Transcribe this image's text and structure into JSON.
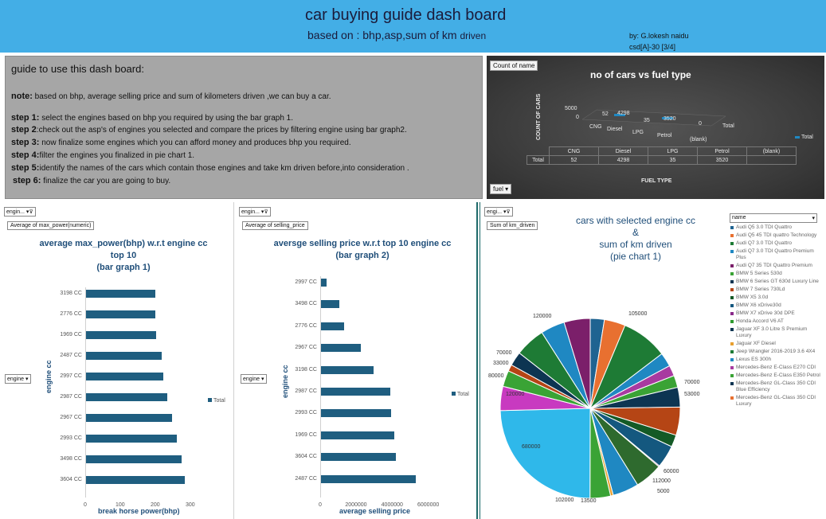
{
  "header": {
    "title": "car buying guide dash board",
    "subtitle_main": "based on : bhp,asp,sum of km",
    "subtitle_small": "driven",
    "author": "by: G.lokesh naidu",
    "class": "csd[A]-30 [3/4]"
  },
  "guide": {
    "heading": "guide to use this dash board:",
    "note_label": "note:",
    "note": " based on bhp, average selling price and sum of kilometers driven ,we can buy a car.",
    "steps": [
      {
        "label": "step 1:",
        "text": " select the engines based on bhp you required by using the bar graph 1."
      },
      {
        "label": "step 2",
        "text": ":check out the asp's of engines you selected and compare the prices by filtering engine using bar graph2."
      },
      {
        "label": "step 3:",
        "text": " now finalize some engines which you can afford money and produces bhp you required."
      },
      {
        "label": "step 4:",
        "text": "filter the engines you finalized in pie chart 1."
      },
      {
        "label": "step 5:",
        "text": "identify the names of the cars which contain those engines and take km driven before,into consideration ."
      },
      {
        "label": "step 6:",
        "text": " finalize the car you are going to buy."
      }
    ]
  },
  "fuel_chart": {
    "field_button": "Count of name",
    "title": "no of cars vs fuel type",
    "ylabel": "COUNT OF CARS",
    "xlabel": "FUEL TYPE",
    "y_ticks": [
      "5000",
      "0"
    ],
    "categories": [
      "CNG",
      "Diesel",
      "LPG",
      "Petrol",
      "(blank)"
    ],
    "values": [
      "52",
      "4298",
      "35",
      "3520",
      "0"
    ],
    "total_label": "Total",
    "legend": "Total",
    "filter_button": "fuel"
  },
  "bar1": {
    "filter": "engin...",
    "field": "Average of max_power(numeric)",
    "title_lines": [
      "average max_power(bhp) w.r.t engine cc",
      "top 10",
      "(bar graph 1)"
    ],
    "row_filter": "engine",
    "ylabel": "engine cc",
    "xlabel": "break horse power(bhp)",
    "legend": "Total",
    "x_ticks": [
      "0",
      "100",
      "200",
      "300"
    ],
    "categories": [
      "3198 CC",
      "2776 CC",
      "1969 CC",
      "2487 CC",
      "2997 CC",
      "2987 CC",
      "2967 CC",
      "2993 CC",
      "3498 CC",
      "3604 CC"
    ],
    "values": [
      197,
      198,
      199,
      215,
      220,
      232,
      245,
      260,
      272,
      282
    ],
    "xlim": [
      0,
      300
    ]
  },
  "bar2": {
    "filter": "engin...",
    "field": "Average of selling_price",
    "title_lines": [
      "aversge selling price w.r.t top 10 engine cc",
      "(bar graph 2)"
    ],
    "row_filter": "engine",
    "ylabel": "engine cc",
    "xlabel": "average selling price",
    "legend": "Total",
    "x_ticks": [
      "0",
      "2000000",
      "4000000",
      "6000000"
    ],
    "categories": [
      "2997 CC",
      "3498 CC",
      "2776 CC",
      "2967 CC",
      "3198 CC",
      "2987 CC",
      "2993 CC",
      "1969 CC",
      "3604 CC",
      "2487 CC"
    ],
    "values": [
      300000,
      1000000,
      1300000,
      2200000,
      2900000,
      3850000,
      3900000,
      4050000,
      4150000,
      5250000
    ],
    "xlim": [
      0,
      6000000
    ]
  },
  "pie": {
    "filter": "engi...",
    "field": "Sum of km_driven",
    "title_lines": [
      "cars with selected engine cc",
      "&",
      "sum of km driven",
      "(pie chart 1)"
    ],
    "legend_filter": "name",
    "legend": [
      {
        "name": "Audi Q5 3.0 TDI Quattro",
        "color": "#1f6391"
      },
      {
        "name": "Audi Q5 45 TDI quattro Technology",
        "color": "#e87030"
      },
      {
        "name": "Audi Q7 3.0 TDI Quattro",
        "color": "#1e7b35"
      },
      {
        "name": "Audi Q7 3.0 TDI Quattro Premium Plus",
        "color": "#1f88c2"
      },
      {
        "name": "Audi Q7 35 TDI Quattro Premium",
        "color": "#7b1f6a"
      },
      {
        "name": "BMW 5 Series 530d",
        "color": "#3aa335"
      },
      {
        "name": "BMW 6 Series GT 630d Luxury Line",
        "color": "#0d3552"
      },
      {
        "name": "BMW 7 Series 730Ld",
        "color": "#b54515"
      },
      {
        "name": "BMW X5 3.0d",
        "color": "#145a26"
      },
      {
        "name": "BMW X6 xDrive30d",
        "color": "#14587f"
      },
      {
        "name": "BMW X7 xDrive 30d DPE",
        "color": "#8a2a8a"
      },
      {
        "name": "Honda Accord V6 AT",
        "color": "#2e9a2e"
      },
      {
        "name": "Jaguar XF 3.0 Litre S Premium Luxury",
        "color": "#0d3552"
      },
      {
        "name": "Jaguar XF Diesel",
        "color": "#e8a030"
      },
      {
        "name": "Jeep Wrangler 2016-2019 3.6 4X4",
        "color": "#1e7b35"
      },
      {
        "name": "Lexus ES 300h",
        "color": "#1f88c2"
      },
      {
        "name": "Mercedes-Benz E-Class E270 CDI",
        "color": "#a83aa0"
      },
      {
        "name": "Mercedes-Benz E-Class E350 Petrol",
        "color": "#3aa335"
      },
      {
        "name": "Mercedes-Benz GL-Class 350 CDI Blue Efficiency",
        "color": "#0d3552"
      },
      {
        "name": "Mercedes-Benz GL-Class 350 CDI Luxury",
        "color": "#e87030"
      }
    ],
    "slices": [
      {
        "value": 70000,
        "color": "#1f6391"
      },
      {
        "value": 105000,
        "color": "#e87030"
      },
      {
        "value": 230000,
        "color": "#1e7b35"
      },
      {
        "value": 70000,
        "color": "#1f88c2"
      },
      {
        "value": 53000,
        "color": "#a83aa0"
      },
      {
        "value": 60000,
        "color": "#3aa335"
      },
      {
        "value": 98000,
        "color": "#0d3552"
      },
      {
        "value": 140000,
        "color": "#b54515"
      },
      {
        "value": 60000,
        "color": "#145a26"
      },
      {
        "value": 112000,
        "color": "#14587f"
      },
      {
        "value": 5000,
        "color": "#7b1f6a"
      },
      {
        "value": 137000,
        "color": "#2e6a2e"
      },
      {
        "value": 130000,
        "color": "#1f88c2"
      },
      {
        "value": 13500,
        "color": "#e8a030"
      },
      {
        "value": 102000,
        "color": "#3aa335"
      },
      {
        "value": 680000,
        "color": "#2fb8ea"
      },
      {
        "value": 120000,
        "color": "#c83ac0"
      },
      {
        "value": 80000,
        "color": "#3aa335"
      },
      {
        "value": 33000,
        "color": "#b54515"
      },
      {
        "value": 70000,
        "color": "#0d3552"
      },
      {
        "value": 150000,
        "color": "#1e7b35"
      },
      {
        "value": 120000,
        "color": "#1f88c2"
      },
      {
        "value": 130000,
        "color": "#7b1f6a"
      }
    ],
    "labels": [
      "105000",
      "120000",
      "70000",
      "33000",
      "80000",
      "120000",
      "680000",
      "102000",
      "13500",
      "5000",
      "112000",
      "60000",
      "53000",
      "70000"
    ]
  }
}
